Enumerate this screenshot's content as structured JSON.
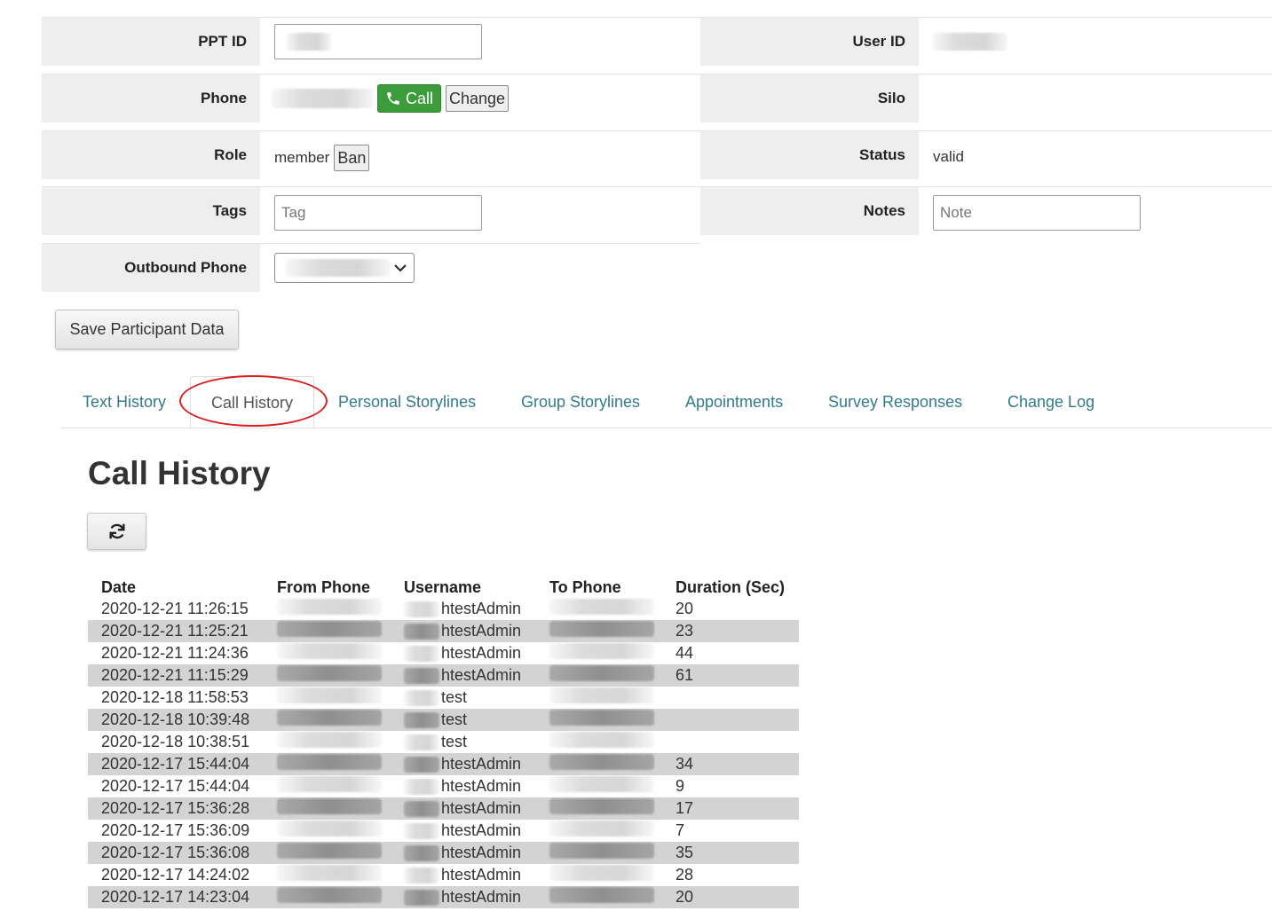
{
  "form": {
    "ppt_id_label": "PPT ID",
    "user_id_label": "User ID",
    "phone_label": "Phone",
    "call_button": "Call",
    "change_button": "Change",
    "silo_label": "Silo",
    "role_label": "Role",
    "role_value": "member",
    "ban_button": "Ban",
    "status_label": "Status",
    "status_value": "valid",
    "tags_label": "Tags",
    "tags_placeholder": "Tag",
    "notes_label": "Notes",
    "notes_placeholder": "Note",
    "outbound_phone_label": "Outbound Phone",
    "save_button": "Save Participant Data"
  },
  "tabs": [
    {
      "label": "Text History",
      "active": false
    },
    {
      "label": "Call History",
      "active": true
    },
    {
      "label": "Personal Storylines",
      "active": false
    },
    {
      "label": "Group Storylines",
      "active": false
    },
    {
      "label": "Appointments",
      "active": false
    },
    {
      "label": "Survey Responses",
      "active": false
    },
    {
      "label": "Change Log",
      "active": false
    }
  ],
  "call_history": {
    "title": "Call History",
    "refresh_icon": "refresh-icon",
    "columns": [
      "Date",
      "From Phone",
      "Username",
      "To Phone",
      "Duration (Sec)"
    ],
    "rows": [
      {
        "date": "2020-12-21 11:26:15",
        "username": "htestAdmin",
        "duration": "20"
      },
      {
        "date": "2020-12-21 11:25:21",
        "username": "htestAdmin",
        "duration": "23"
      },
      {
        "date": "2020-12-21 11:24:36",
        "username": "htestAdmin",
        "duration": "44"
      },
      {
        "date": "2020-12-21 11:15:29",
        "username": "htestAdmin",
        "duration": "61"
      },
      {
        "date": "2020-12-18 11:58:53",
        "username": "test",
        "duration": ""
      },
      {
        "date": "2020-12-18 10:39:48",
        "username": "test",
        "duration": ""
      },
      {
        "date": "2020-12-18 10:38:51",
        "username": "test",
        "duration": ""
      },
      {
        "date": "2020-12-17 15:44:04",
        "username": "htestAdmin",
        "duration": "34"
      },
      {
        "date": "2020-12-17 15:44:04",
        "username": "htestAdmin",
        "duration": "9"
      },
      {
        "date": "2020-12-17 15:36:28",
        "username": "htestAdmin",
        "duration": "17"
      },
      {
        "date": "2020-12-17 15:36:09",
        "username": "htestAdmin",
        "duration": "7"
      },
      {
        "date": "2020-12-17 15:36:08",
        "username": "htestAdmin",
        "duration": "35"
      },
      {
        "date": "2020-12-17 14:24:02",
        "username": "htestAdmin",
        "duration": "28"
      },
      {
        "date": "2020-12-17 14:23:04",
        "username": "htestAdmin",
        "duration": "20"
      }
    ]
  },
  "colors": {
    "label_bg": "#eeeeee",
    "call_green": "#3c9c3c",
    "tab_link": "#337a8a",
    "stripe": "#d3d3d3",
    "highlight": "#d81e1e"
  }
}
